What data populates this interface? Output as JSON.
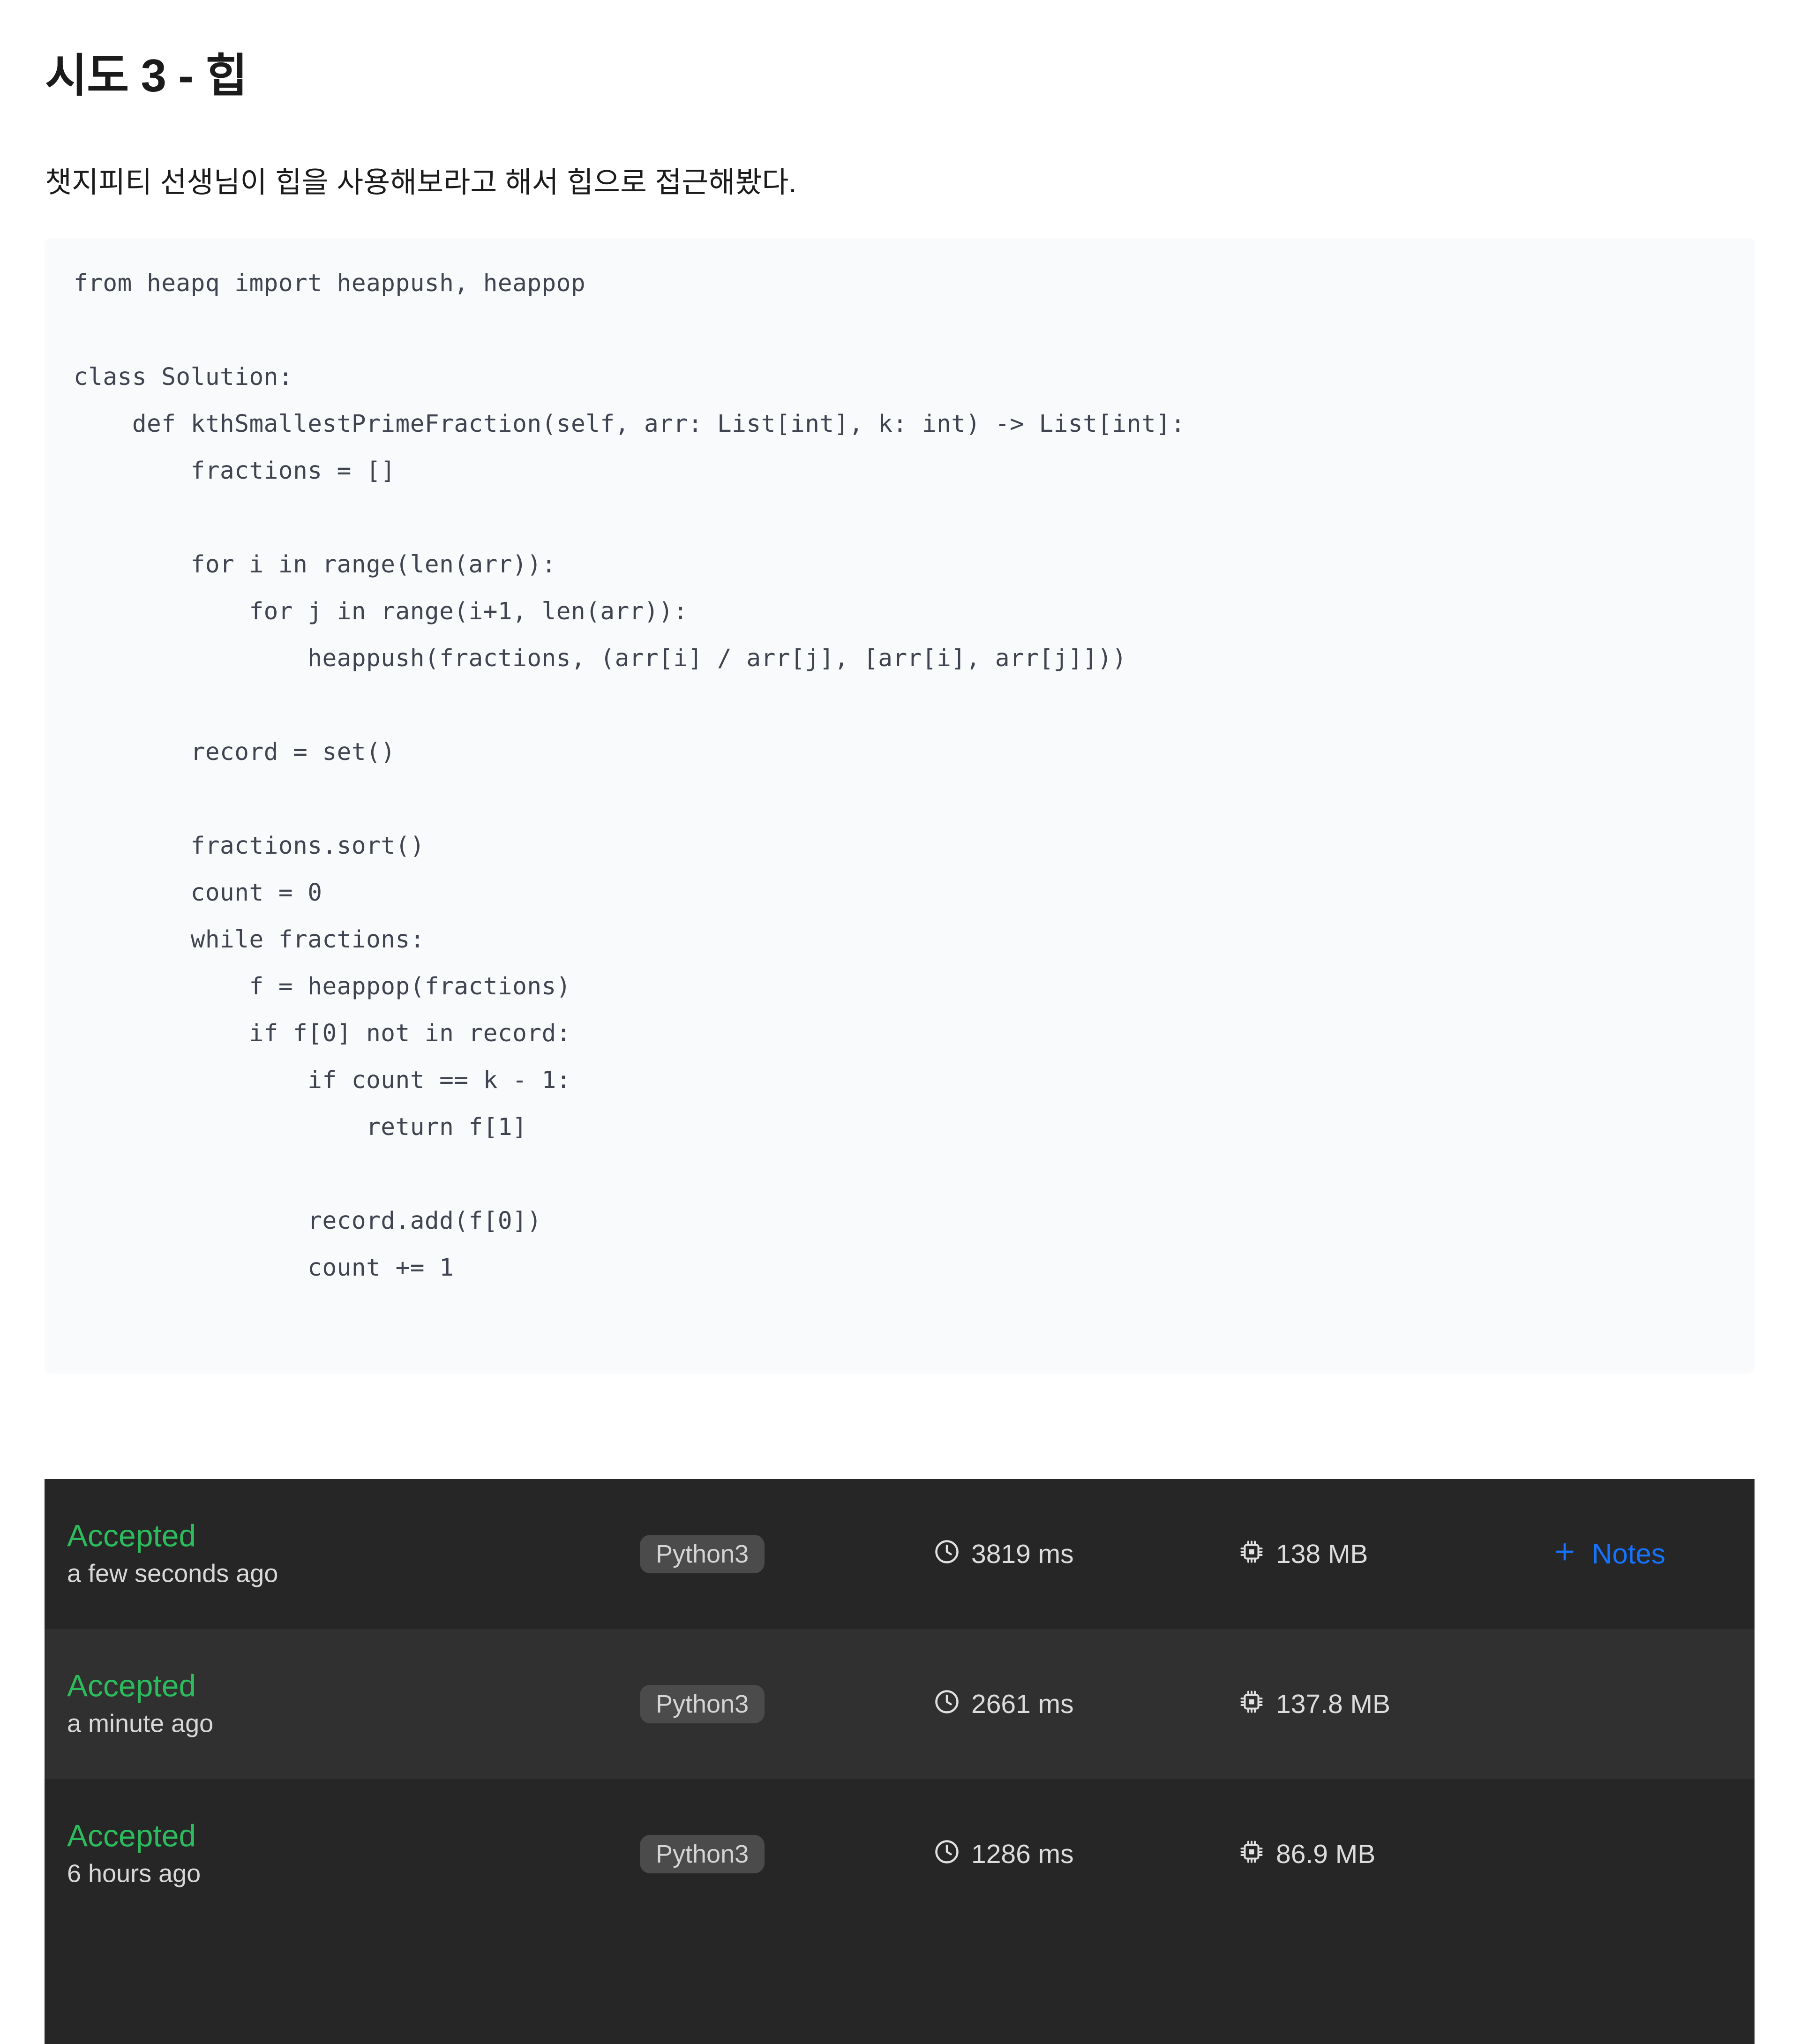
{
  "page": {
    "title": "시도 3 - 힙",
    "intro": "챗지피티 선생님이 힙을 사용해보라고 해서 힙으로 접근해봤다."
  },
  "code_block": {
    "language": "python",
    "lines": [
      "from heapq import heappush, heappop",
      "",
      "class Solution:",
      "    def kthSmallestPrimeFraction(self, arr: List[int], k: int) -> List[int]:",
      "        fractions = []",
      "",
      "        for i in range(len(arr)):",
      "            for j in range(i+1, len(arr)):",
      "                heappush(fractions, (arr[i] / arr[j], [arr[i], arr[j]]))",
      "",
      "        record = set()",
      "",
      "        fractions.sort()",
      "        count = 0",
      "        while fractions:",
      "            f = heappop(fractions)",
      "            if f[0] not in record:",
      "                if count == k - 1:",
      "                    return f[1]",
      "",
      "                record.add(f[0])",
      "                count += 1"
    ]
  },
  "submissions": {
    "colors": {
      "accepted": "#2cbb5d",
      "notes_link": "#1473ff",
      "panel_bg": "#262626",
      "row_alt_bg": "#303030",
      "badge_bg": "#4b4b4b"
    },
    "rows": [
      {
        "status": "Accepted",
        "time_ago": "a few seconds ago",
        "language": "Python3",
        "runtime": "3819 ms",
        "memory": "138 MB",
        "notes_label": "Notes",
        "has_notes": true,
        "runtime_icon": "clock-icon",
        "memory_icon": "chip-icon"
      },
      {
        "status": "Accepted",
        "time_ago": "a minute ago",
        "language": "Python3",
        "runtime": "2661 ms",
        "memory": "137.8 MB",
        "notes_label": "",
        "has_notes": false,
        "runtime_icon": "clock-icon",
        "memory_icon": "chip-icon"
      },
      {
        "status": "Accepted",
        "time_ago": "6 hours ago",
        "language": "Python3",
        "runtime": "1286 ms",
        "memory": "86.9 MB",
        "notes_label": "",
        "has_notes": false,
        "runtime_icon": "clock-icon",
        "memory_icon": "chip-icon"
      }
    ]
  }
}
